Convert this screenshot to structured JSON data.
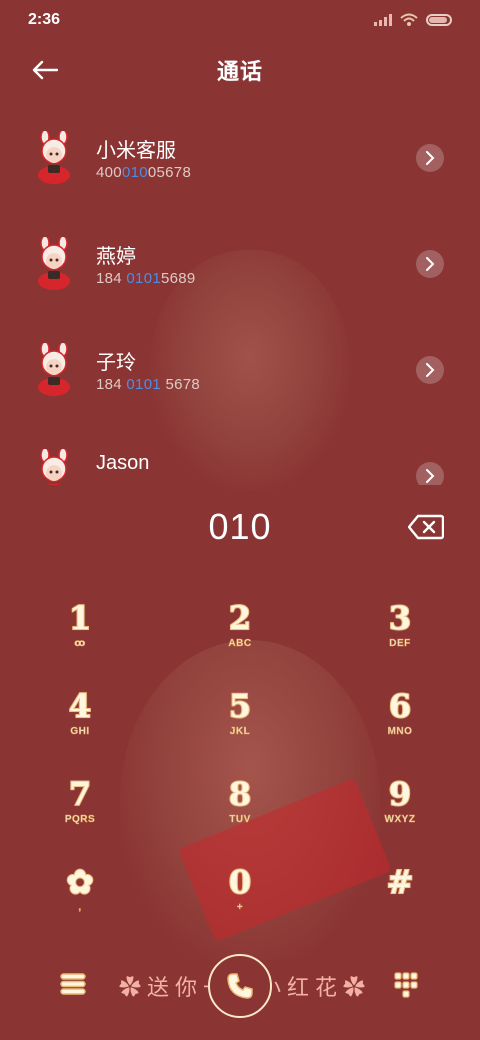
{
  "status": {
    "time": "2:36"
  },
  "header": {
    "title": "通话"
  },
  "contacts": [
    {
      "name": "小米客服",
      "num_pre": "400",
      "num_hl": "010",
      "num_post": "05678"
    },
    {
      "name": "燕婷",
      "num_pre": "184 ",
      "num_hl": "0101",
      "num_post": "5689"
    },
    {
      "name": "子玲",
      "num_pre": "184 ",
      "num_hl": "0101",
      "num_post": " 5678"
    },
    {
      "name": "Jason",
      "num_pre": "",
      "num_hl": "",
      "num_post": ""
    }
  ],
  "dialer": {
    "number": "010"
  },
  "keypad": [
    {
      "digit": "1",
      "letters": "ꝏ"
    },
    {
      "digit": "2",
      "letters": "ABC"
    },
    {
      "digit": "3",
      "letters": "DEF"
    },
    {
      "digit": "4",
      "letters": "GHI"
    },
    {
      "digit": "5",
      "letters": "JKL"
    },
    {
      "digit": "6",
      "letters": "MNO"
    },
    {
      "digit": "7",
      "letters": "PQRS"
    },
    {
      "digit": "8",
      "letters": "TUV"
    },
    {
      "digit": "9",
      "letters": "WXYZ"
    },
    {
      "digit": "✿",
      "letters": ","
    },
    {
      "digit": "0",
      "letters": "+"
    },
    {
      "digit": "#",
      "letters": ""
    }
  ],
  "bottom": {
    "slogan": "✿送你一朵小红花✿"
  },
  "colors": {
    "background": "#8a3434",
    "highlight": "#4a8ee8",
    "keypad_text": "#fff6df"
  },
  "icons": [
    "back-arrow-icon",
    "chevron-right-icon",
    "backspace-icon",
    "menu-icon",
    "phone-icon",
    "grid-icon",
    "signal-icon",
    "wifi-icon",
    "battery-icon"
  ]
}
